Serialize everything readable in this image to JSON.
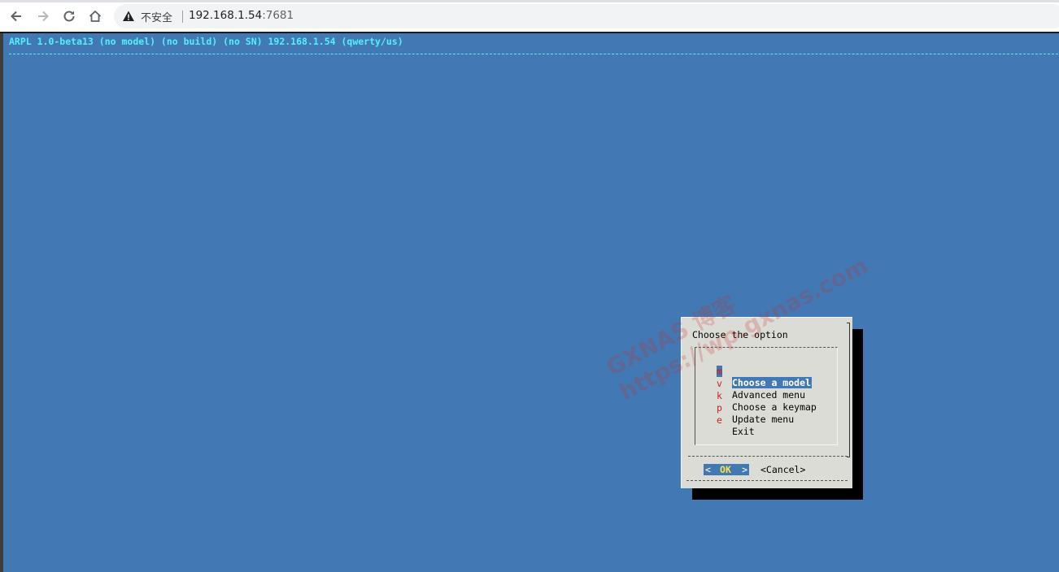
{
  "browser": {
    "security_label": "不安全",
    "url_host": "192.168.1.54",
    "url_port": ":7681",
    "icons": [
      "back-arrow-icon",
      "forward-arrow-icon",
      "reload-icon",
      "home-icon",
      "warning-icon"
    ]
  },
  "terminal": {
    "title": "ARPL 1.0-beta13 (no model) (no build) (no SN) 192.168.1.54 (qwerty/us)",
    "colors": {
      "background": "#4279b4",
      "title": "#52f0ff",
      "dialog_bg": "#dcdcd6",
      "hotkey": "#cc1f1f",
      "ok_text": "#ffe14d"
    }
  },
  "dialog": {
    "prompt": "Choose the option",
    "menu": [
      {
        "key": "m",
        "label": "Choose a model",
        "selected": true
      },
      {
        "key": "v",
        "label": "Advanced menu",
        "selected": false
      },
      {
        "key": "k",
        "label": "Choose a keymap",
        "selected": false
      },
      {
        "key": "p",
        "label": "Update menu",
        "selected": false
      },
      {
        "key": "e",
        "label": "Exit",
        "selected": false
      }
    ],
    "ok_button": {
      "left": "<",
      "hot": "O",
      "rest": "K",
      "right": ">"
    },
    "cancel_button": "<Cancel>"
  },
  "watermark": {
    "line1": "GXNAS 博客",
    "line2": "https://wp.gxnas.com"
  }
}
